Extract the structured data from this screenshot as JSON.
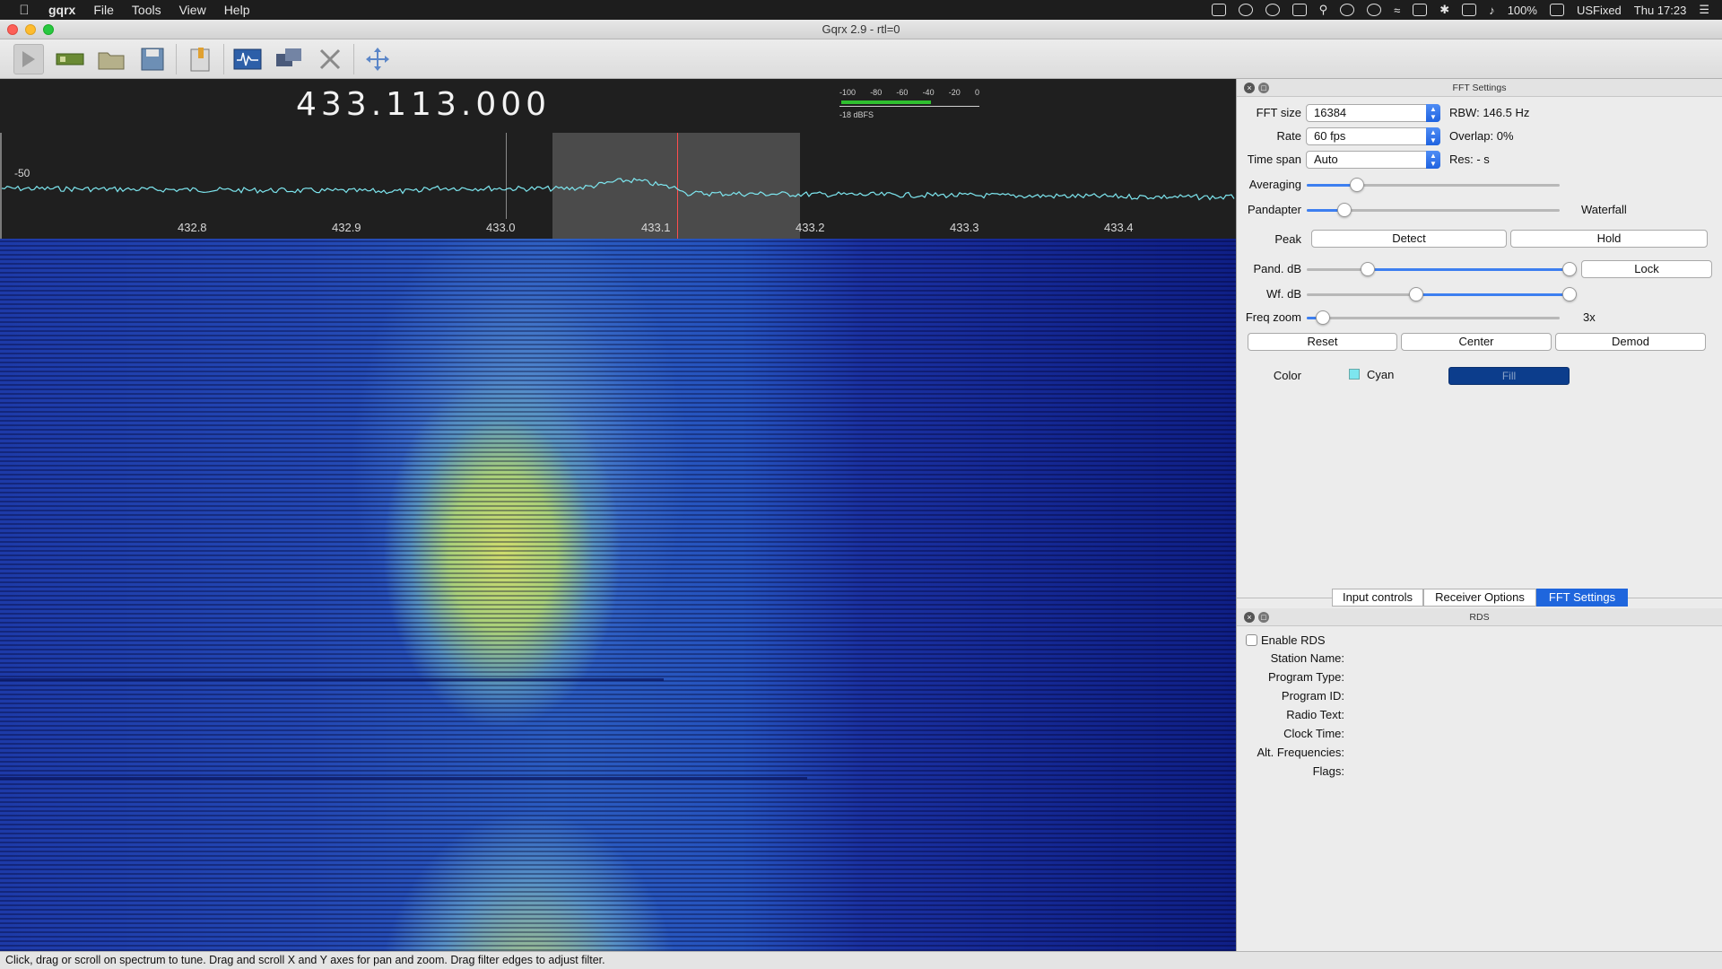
{
  "menubar": {
    "app": "gqrx",
    "items": [
      "File",
      "Tools",
      "View",
      "Help"
    ],
    "status": {
      "battery": "100%",
      "input_source": "USFixed",
      "clock": "Thu 17:23"
    }
  },
  "window": {
    "title": "Gqrx 2.9 - rtl=0"
  },
  "toolbar": {
    "buttons": [
      "play-icon",
      "device-icon",
      "open-folder-icon",
      "save-icon",
      "bookmark-icon",
      "signal-icon",
      "remote-icon",
      "tools-icon",
      "fullscreen-icon"
    ]
  },
  "plot": {
    "frequency": "433.113.000",
    "smeter": {
      "ticks": [
        "-100",
        "-80",
        "-60",
        "-40",
        "-20",
        "0"
      ],
      "level_label": "-18 dBFS",
      "level_fraction": 0.66
    },
    "db_label": "-50",
    "freq_ticks": [
      "432.8",
      "432.9",
      "433.0",
      "433.1",
      "433.2",
      "433.3",
      "433.4"
    ],
    "trace_color": "#7de6ef"
  },
  "status_bar": "Click, drag or scroll on spectrum to tune. Drag and scroll X and Y axes for pan and zoom. Drag filter edges to adjust filter.",
  "fft_settings": {
    "title": "FFT Settings",
    "fft_size_label": "FFT size",
    "fft_size": "16384",
    "rbw": "RBW: 146.5 Hz",
    "rate_label": "Rate",
    "rate": "60 fps",
    "overlap": "Overlap: 0%",
    "timespan_label": "Time span",
    "timespan": "Auto",
    "res": "Res: - s",
    "averaging_label": "Averaging",
    "averaging_value": 0.2,
    "pandapter_label": "Pandapter",
    "waterfall_label": "Waterfall",
    "pandapter_value": 0.15,
    "peak_label": "Peak",
    "detect": "Detect",
    "hold": "Hold",
    "pand_db_label": "Pand. dB",
    "lock": "Lock",
    "wf_db_label": "Wf. dB",
    "freq_zoom_label": "Freq zoom",
    "freq_zoom_value": "3x",
    "reset": "Reset",
    "center": "Center",
    "demod": "Demod",
    "color_label": "Color",
    "color_name": "Cyan",
    "fill": "Fill",
    "accent": "#1f66dd"
  },
  "tabs": [
    "Input controls",
    "Receiver Options",
    "FFT Settings"
  ],
  "rds": {
    "title": "RDS",
    "enable": "Enable RDS",
    "fields": [
      "Station Name:",
      "Program Type:",
      "Program ID:",
      "Radio Text:",
      "Clock Time:",
      "Alt. Frequencies:",
      "Flags:"
    ]
  }
}
